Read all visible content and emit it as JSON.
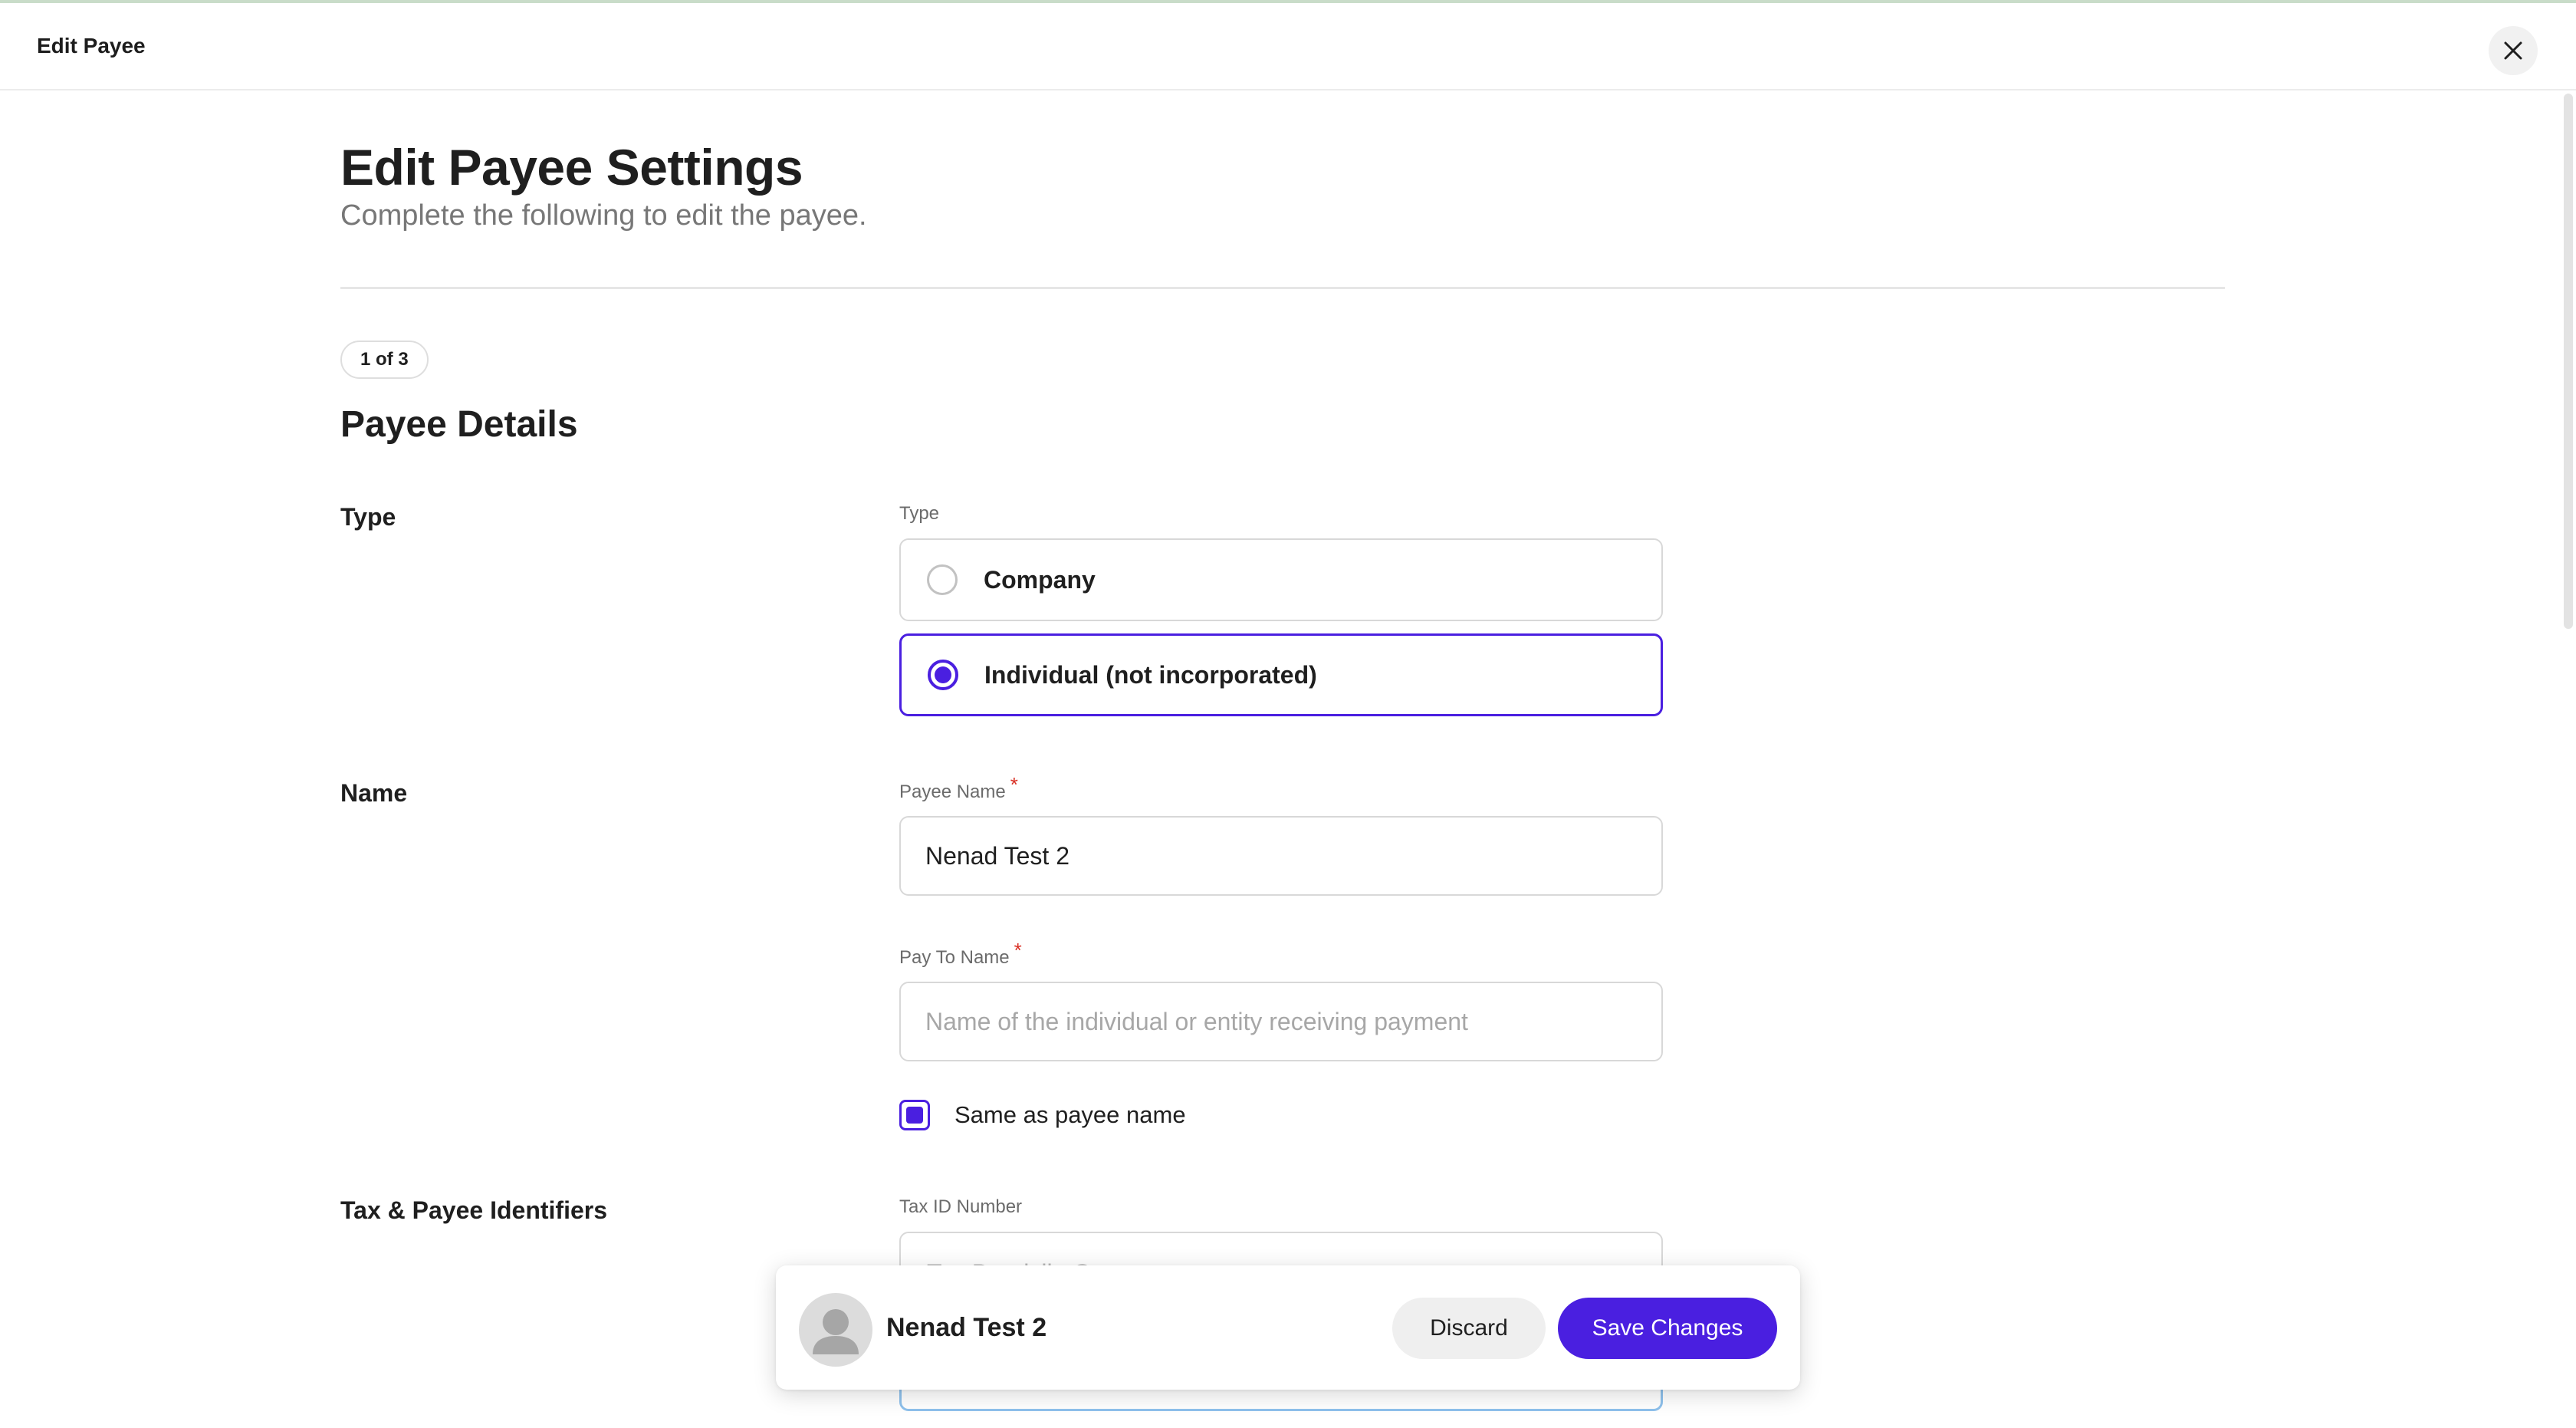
{
  "header": {
    "title": "Edit Payee",
    "close_icon": "close-icon"
  },
  "page": {
    "title": "Edit Payee Settings",
    "subtitle": "Complete the following to edit the payee.",
    "step": "1 of 3",
    "section_title": "Payee Details"
  },
  "type_section": {
    "row_label": "Type",
    "field_label": "Type",
    "options": [
      {
        "label": "Company",
        "selected": false
      },
      {
        "label": "Individual (not incorporated)",
        "selected": true
      }
    ]
  },
  "name_section": {
    "row_label": "Name",
    "payee_name": {
      "label": "Payee Name",
      "required_mark": "*",
      "value": "Nenad Test 2"
    },
    "pay_to_name": {
      "label": "Pay To Name",
      "required_mark": "*",
      "value": "",
      "placeholder": "Name of the individual or entity receiving payment"
    },
    "same_as_checkbox": {
      "label": "Same as payee name",
      "checked": true
    }
  },
  "tax_section": {
    "row_label": "Tax & Payee Identifiers",
    "field_label": "Tax ID Number",
    "partial_placeholder": "Tax Domicile Country"
  },
  "floating_bar": {
    "name": "Nenad Test 2",
    "discard_label": "Discard",
    "save_label": "Save Changes"
  },
  "colors": {
    "accent": "#4a1fe0",
    "border": "#d8d8d8",
    "muted_text": "#777777",
    "required": "#d93025"
  }
}
